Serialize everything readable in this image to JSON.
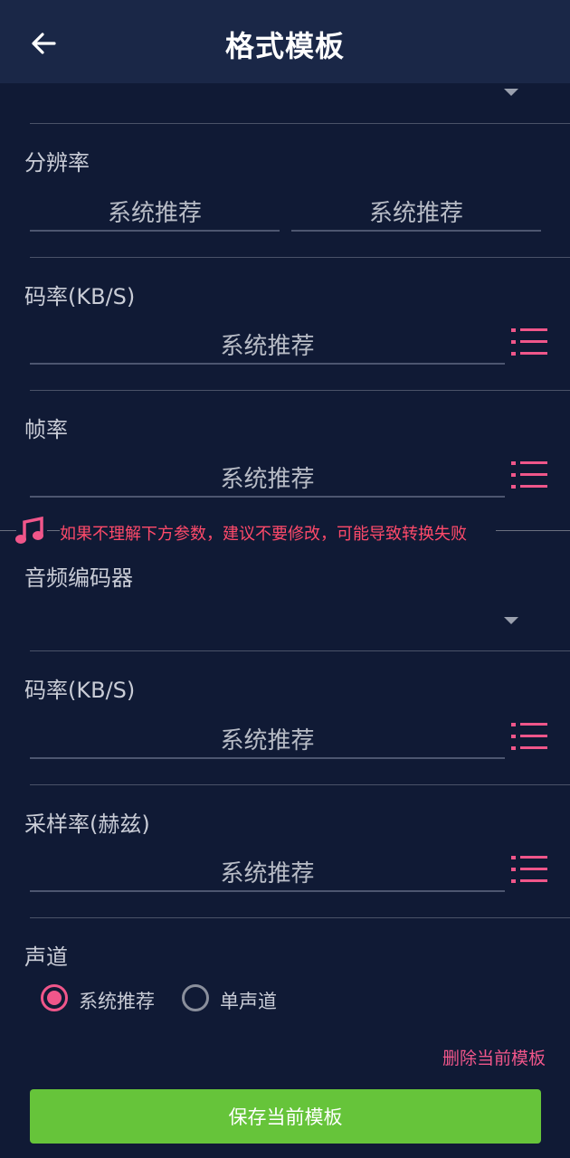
{
  "header": {
    "title": "格式模板",
    "back_icon": "arrow-left-icon"
  },
  "video": {
    "resolution": {
      "label": "分辨率",
      "width_value": "系统推荐",
      "height_value": "系统推荐"
    },
    "bitrate": {
      "label": "码率(KB/S)",
      "value": "系统推荐"
    },
    "framerate": {
      "label": "帧率",
      "value": "系统推荐"
    }
  },
  "warning": {
    "text": "如果不理解下方参数，建议不要修改，可能导致转换失败",
    "icon": "music-note-icon"
  },
  "audio": {
    "codec": {
      "label": "音频编码器",
      "value": ""
    },
    "bitrate": {
      "label": "码率(KB/S)",
      "value": "系统推荐"
    },
    "samplerate": {
      "label": "采样率(赫兹)",
      "value": "系统推荐"
    },
    "channel": {
      "label": "声道",
      "options": [
        {
          "label": "系统推荐",
          "selected": true
        },
        {
          "label": "单声道",
          "selected": false
        }
      ]
    }
  },
  "actions": {
    "delete_label": "删除当前模板",
    "save_label": "保存当前模板"
  },
  "colors": {
    "background": "#101a35",
    "appbar": "#1a2747",
    "accent": "#f0568a",
    "save": "#66c43a",
    "warning": "#ff4a6a"
  }
}
